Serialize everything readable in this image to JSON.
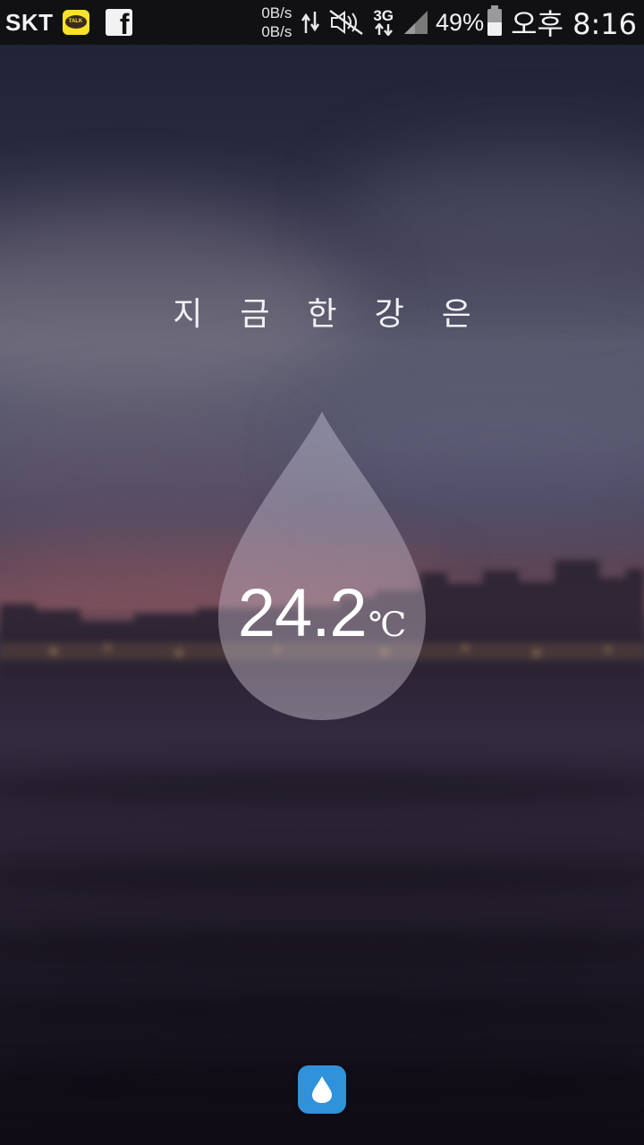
{
  "status_bar": {
    "carrier": "SKT",
    "net_speed_up": "0B/s",
    "net_speed_down": "0B/s",
    "network_type": "3G",
    "battery_percent": "49%",
    "battery_level": 0.49,
    "time": "오후 8:16",
    "icons": [
      "kakaotalk-icon",
      "facebook-icon",
      "data-transfer-icon",
      "mute-icon",
      "3g-icon",
      "signal-icon",
      "battery-icon"
    ]
  },
  "main": {
    "heading_chars": [
      "지",
      "금",
      "한",
      "강",
      "은"
    ],
    "temperature_value": "24.2",
    "temperature_unit": "℃",
    "button_icon": "water-drop-icon"
  },
  "colors": {
    "status_bar_bg": "#111114",
    "drop_fill": "rgba(200,200,215,0.45)",
    "button_bg": "#2f92db",
    "text": "#ffffff"
  }
}
